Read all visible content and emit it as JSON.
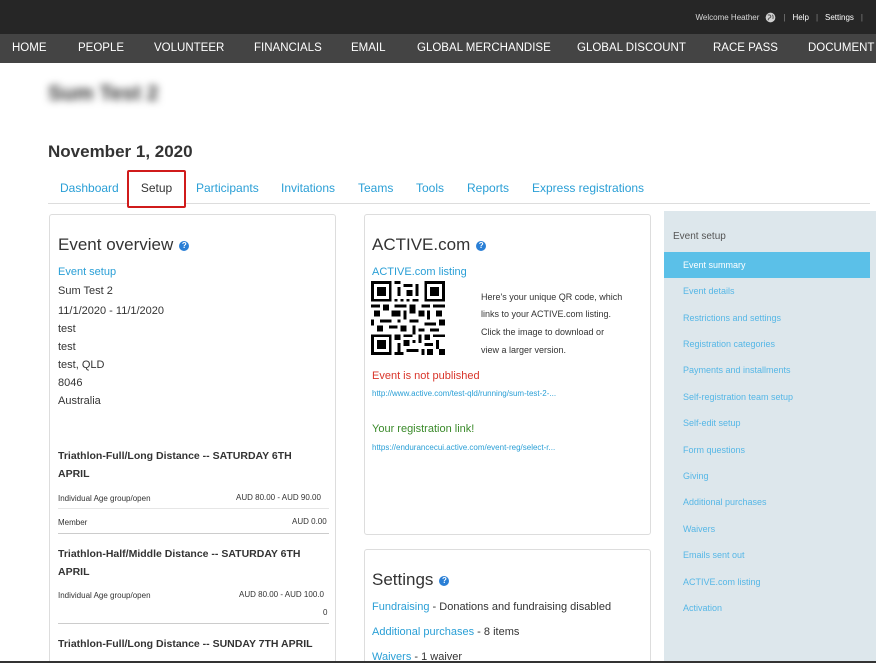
{
  "topbar": {
    "welcome": "Welcome Heather",
    "help": "Help",
    "settings": "Settings",
    "sep": "|"
  },
  "nav": [
    "HOME",
    "PEOPLE",
    "VOLUNTEER",
    "FINANCIALS",
    "EMAIL",
    "GLOBAL MERCHANDISE",
    "GLOBAL DISCOUNT",
    "RACE PASS",
    "DOCUMENT"
  ],
  "event": {
    "name": "Sum Test 2",
    "date": "November 1, 2020"
  },
  "tabs": [
    "Dashboard",
    "Setup",
    "Participants",
    "Invitations",
    "Teams",
    "Tools",
    "Reports",
    "Express registrations"
  ],
  "overview": {
    "title": "Event overview",
    "help": "?",
    "setup_link": "Event setup",
    "lines": [
      "Sum Test 2",
      "11/1/2020 - 11/1/2020",
      "test",
      "test",
      "test, QLD",
      "8046",
      "Australia"
    ],
    "categories": [
      {
        "title_l1": "Triathlon-Full/Long Distance -- SATURDAY 6TH",
        "title_l2": "APRIL",
        "row1_label": "Individual Age group/open",
        "row1_price": "AUD 80.00 - AUD 90.00",
        "row2_label": "Member",
        "row2_price": "AUD 0.00"
      },
      {
        "title_l1": "Triathlon-Half/Middle Distance -- SATURDAY 6TH",
        "title_l2": "APRIL",
        "row1_label": "Individual Age group/open",
        "row1_price": "AUD 80.00 - AUD 100.0",
        "row1_price_wrap": "0"
      },
      {
        "title_l1": "Triathlon-Full/Long Distance -- SUNDAY 7TH APRIL"
      }
    ]
  },
  "active": {
    "title": "ACTIVE.com",
    "help": "?",
    "listing_link": "ACTIVE.com listing",
    "qr_text": [
      "Here's your unique QR code, which",
      "links to your ACTIVE.com listing.",
      "Click the image to download or",
      "view a larger version."
    ],
    "not_published": "Event is not published",
    "event_url": "http://www.active.com/test-qld/running/sum-test-2-...",
    "reg_label": "Your registration link!",
    "reg_url": "https://endurancecui.active.com/event-reg/select-r..."
  },
  "settings_card": {
    "title": "Settings",
    "help": "?",
    "rows": [
      {
        "link": "Fundraising",
        "text": " - Donations and fundraising disabled"
      },
      {
        "link": "Additional purchases",
        "text": " - 8 items"
      },
      {
        "link": "Waivers",
        "text": " - 1 waiver"
      }
    ]
  },
  "sidebar": {
    "title": "Event setup",
    "items": [
      "Event summary",
      "Event details",
      "Restrictions and settings",
      "Registration categories",
      "Payments and installments",
      "Self-registration team setup",
      "Self-edit setup",
      "Form questions",
      "Giving",
      "Additional purchases",
      "Waivers",
      "Emails sent out",
      "ACTIVE.com listing",
      "Activation"
    ]
  },
  "colors": {
    "accent": "#2a9fd6",
    "active_sidebar": "#5bc0e8",
    "highlight_box": "#d01b1b",
    "not_published": "#d9352a",
    "reg_green": "#3a8a2a"
  }
}
